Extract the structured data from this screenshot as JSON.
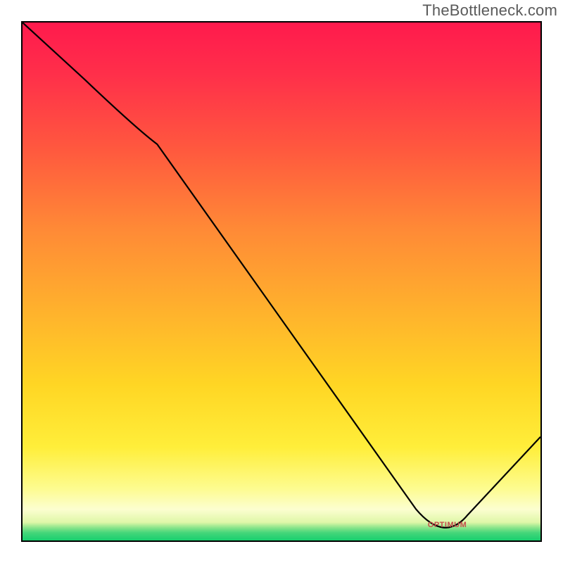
{
  "watermark": "TheBottleneck.com",
  "min_marker": {
    "label": "OPTIMUM",
    "x_pct": 82,
    "y_pct": 97
  },
  "chart_data": {
    "type": "line",
    "title": "",
    "xlabel": "",
    "ylabel": "",
    "x": [
      0,
      25,
      82,
      100
    ],
    "values": [
      100,
      78,
      0,
      20
    ],
    "ylim": [
      0,
      100
    ],
    "xlim": [
      0,
      100
    ],
    "annotations": [
      "OPTIMUM"
    ]
  }
}
